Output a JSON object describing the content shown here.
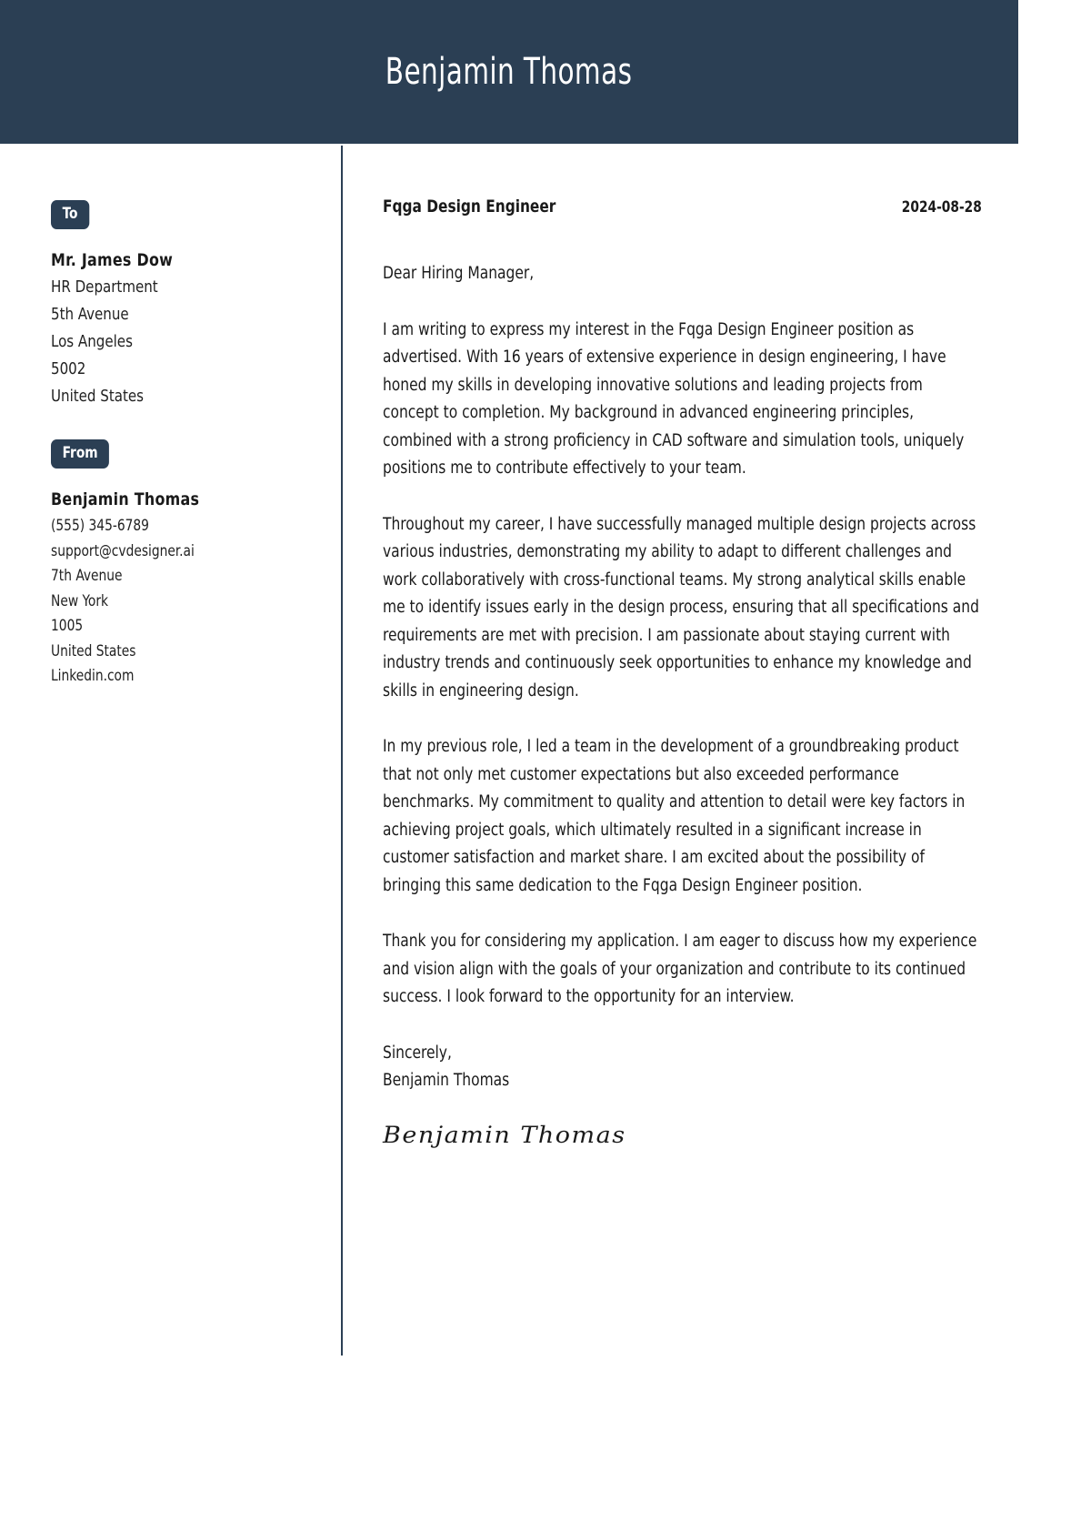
{
  "header": {
    "full_name": "Benjamin Thomas",
    "background_color": "#2b3f54",
    "text_color": "#ffffff"
  },
  "sidebar": {
    "to": {
      "badge_label": "To",
      "name": "Mr. James Dow",
      "lines": [
        "HR Department",
        "5th Avenue",
        "Los Angeles",
        "5002",
        "United States"
      ]
    },
    "from": {
      "badge_label": "From",
      "name": "Benjamin Thomas",
      "lines": [
        "(555) 345-6789",
        "support@cvdesigner.ai",
        "7th Avenue",
        "New York",
        "1005",
        "United States",
        "Linkedin.com"
      ]
    }
  },
  "letter": {
    "job_title": "Fqga Design Engineer",
    "date": "2024-08-28",
    "salutation": "Dear Hiring Manager,",
    "paragraphs": [
      "I am writing to express my interest in the Fqga Design Engineer position as advertised. With 16 years of extensive experience in design engineering, I have honed my skills in developing innovative solutions and leading projects from concept to completion. My background in advanced engineering principles, combined with a strong proficiency in CAD software and simulation tools, uniquely positions me to contribute effectively to your team.",
      "Throughout my career, I have successfully managed multiple design projects across various industries, demonstrating my ability to adapt to different challenges and work collaboratively with cross-functional teams. My strong analytical skills enable me to identify issues early in the design process, ensuring that all specifications and requirements are met with precision. I am passionate about staying current with industry trends and continuously seek opportunities to enhance my knowledge and skills in engineering design.",
      "In my previous role, I led a team in the development of a groundbreaking product that not only met customer expectations but also exceeded performance benchmarks. My commitment to quality and attention to detail were key factors in achieving project goals, which ultimately resulted in a significant increase in customer satisfaction and market share. I am excited about the possibility of bringing this same dedication to the Fqga Design Engineer position.",
      "Thank you for considering my application. I am eager to discuss how my experience and vision align with the goals of your organization and contribute to its continued success. I look forward to the opportunity for an interview."
    ],
    "closing_word": "Sincerely,",
    "closing_name": "Benjamin Thomas",
    "signature": "Benjamin Thomas"
  }
}
